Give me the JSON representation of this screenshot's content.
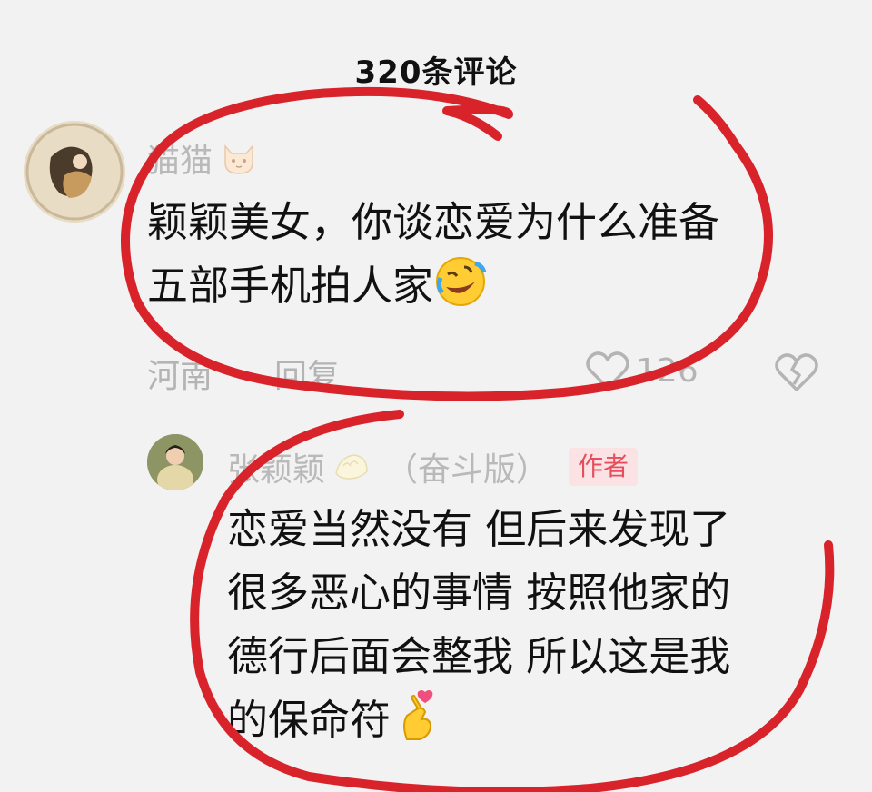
{
  "header": {
    "title": "320条评论"
  },
  "comment": {
    "username": "猫猫",
    "username_emoji": "cat-face-emoji",
    "text_line1": "颖颖美女，你谈恋爱为什么准备",
    "text_line2": "五部手机拍人家",
    "text_emoji": "rolling-laughing-emoji",
    "location": "河南",
    "reply_label": "回复",
    "like_count": "126"
  },
  "reply": {
    "username": "张颖颖",
    "username_emoji": "dumpling-emoji",
    "edition": "（奋斗版）",
    "author_badge": "作者",
    "text_line1": "恋爱当然没有 但后来发现了",
    "text_line2": "很多恶心的事情 按照他家的",
    "text_line3": "德行后面会整我 所以这是我",
    "text_line4": "的保命符",
    "text_emoji": "finger-heart-emoji"
  },
  "colors": {
    "background": "#f2f2f2",
    "muted_text": "#b4b4b4",
    "author_badge_bg": "#fbe2e4",
    "author_badge_text": "#e84d5b",
    "annotation_red": "#d9232b"
  }
}
